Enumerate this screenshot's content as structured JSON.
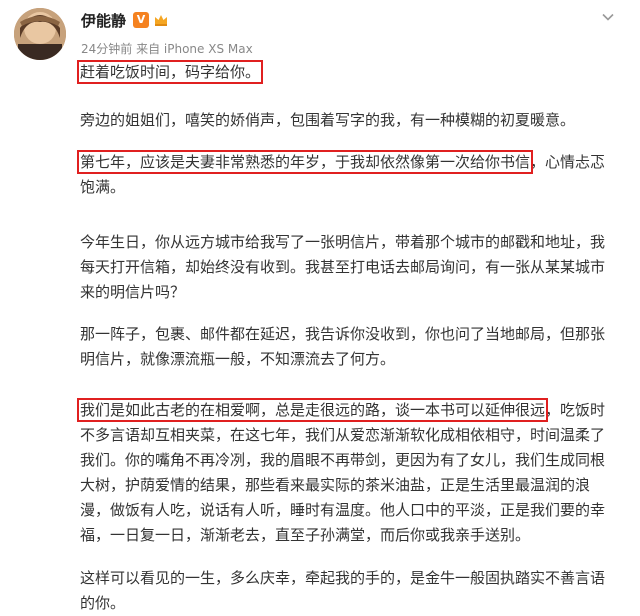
{
  "post": {
    "username": "伊能静",
    "vip_badge": "V",
    "meta": "24分钟前 来自 iPhone XS Max",
    "paragraphs": [
      {
        "lines": [
          {
            "parts": [
              {
                "text": "赶着吃饭时间，码字给你。",
                "hl": true
              }
            ]
          }
        ]
      },
      {
        "lines": [
          {
            "parts": [
              {
                "text": "旁边的姐姐们，嘻笑的娇俏声，包围着写字的我，有一种模糊的初夏暖意。"
              }
            ]
          }
        ]
      },
      {
        "lines": [
          {
            "parts": [
              {
                "text": "第七年，应该是夫妻非常熟悉的年岁，于我却依然像第一次给你书信",
                "hl": true
              },
              {
                "text": "，心情忐忑"
              }
            ]
          },
          {
            "parts": [
              {
                "text": "饱满。"
              }
            ]
          }
        ]
      },
      {
        "lines": [
          {
            "parts": [
              {
                "text": "今年生日，你从远方城市给我写了一张明信片，带着那个城市的邮戳和地址，我"
              }
            ]
          },
          {
            "parts": [
              {
                "text": "每天打开信箱，却始终没有收到。我甚至打电话去邮局询问，有一张从某某城市"
              }
            ]
          },
          {
            "parts": [
              {
                "text": "来的明信片吗？"
              }
            ]
          }
        ]
      },
      {
        "lines": [
          {
            "parts": [
              {
                "text": "那一阵子，包裹、邮件都在延迟，我告诉你没收到，你也问了当地邮局，但那张"
              }
            ]
          },
          {
            "parts": [
              {
                "text": "明信片，就像漂流瓶一般，不知漂流去了何方。"
              }
            ]
          }
        ]
      },
      {
        "lines": [
          {
            "parts": [
              {
                "text": "我们是如此古老的在相爱啊，总是走很远的路，谈一本书可以延伸很远",
                "hl": true
              },
              {
                "text": "，吃饭时"
              }
            ]
          },
          {
            "parts": [
              {
                "text": "不多言语却互相夹菜，在这七年，我们从爱恋渐渐软化成相依相守，时间温柔了"
              }
            ]
          },
          {
            "parts": [
              {
                "text": "我们。你的嘴角不再冷冽，我的眉眼不再带剑，更因为有了女儿，我们生成同根"
              }
            ]
          },
          {
            "parts": [
              {
                "text": "大树，护荫爱情的结果，那些看来最实际的茶米油盐，正是生活里最温润的浪"
              }
            ]
          },
          {
            "parts": [
              {
                "text": "漫，做饭有人吃，说话有人听，睡时有温度。他人口中的平淡，正是我们要的幸"
              }
            ]
          },
          {
            "parts": [
              {
                "text": "福，一日复一日，渐渐老去，直至子孙满堂，而后你或我亲手送别。"
              }
            ]
          }
        ]
      },
      {
        "lines": [
          {
            "parts": [
              {
                "text": "这样可以看见的一生，多么庆幸，牵起我的手的，是金牛一般固执踏实不善言语"
              }
            ]
          },
          {
            "parts": [
              {
                "text": "的你。"
              }
            ]
          }
        ]
      }
    ]
  },
  "colors": {
    "highlight_box": "#e02020",
    "vip_badge": "#f58220",
    "meta_text": "#888888"
  },
  "icons": {
    "chevron": "chevron-down-icon",
    "crown": "crown-icon"
  }
}
